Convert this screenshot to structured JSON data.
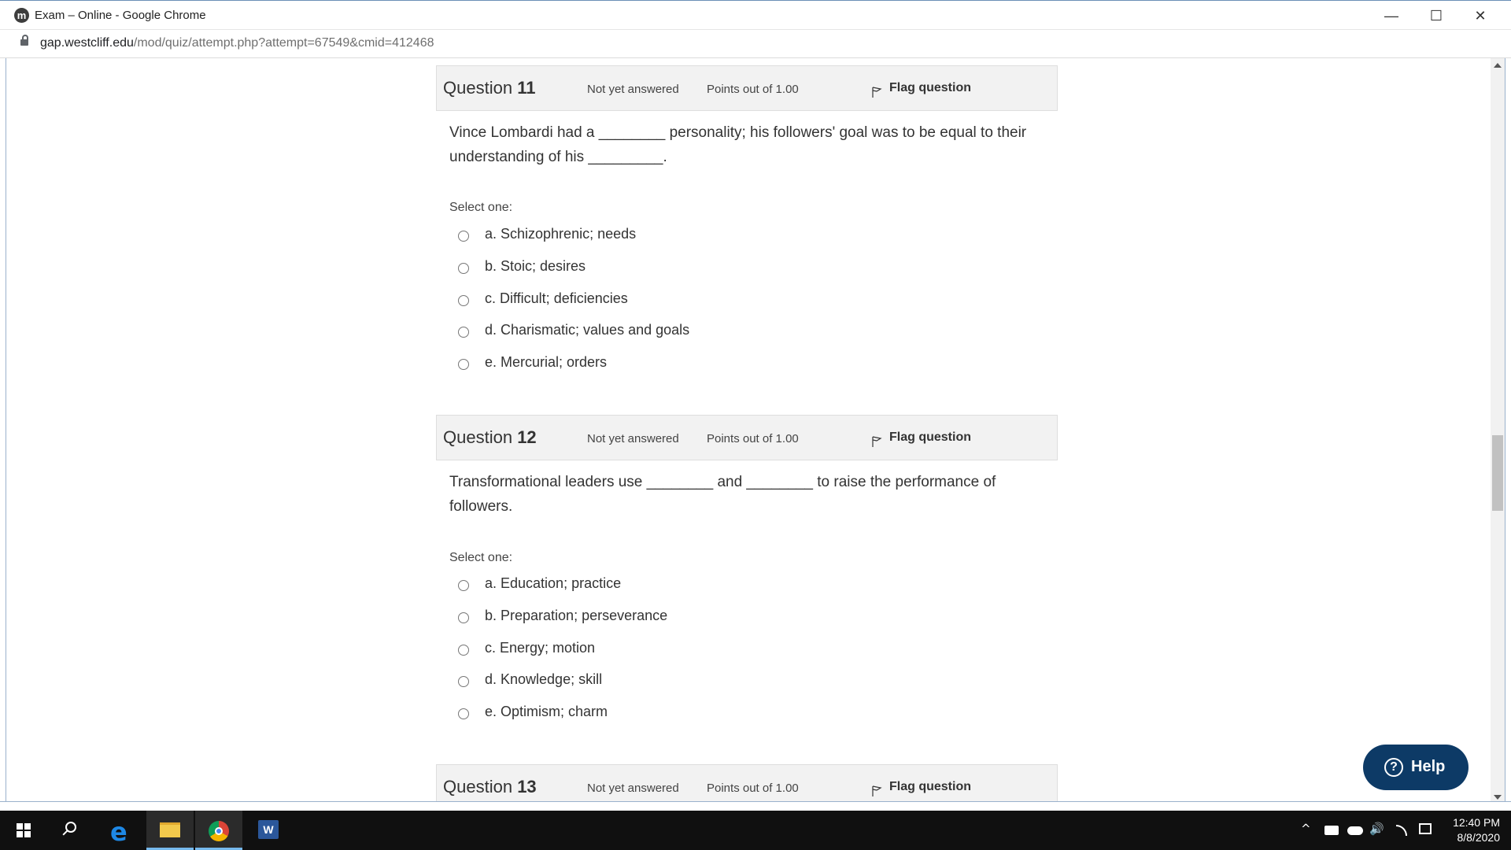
{
  "window": {
    "title": "Exam – Online - Google Chrome",
    "app_icon_letter": "m",
    "minimize": "—",
    "maximize": "☐",
    "close": "✕"
  },
  "address": {
    "host": "gap.westcliff.edu",
    "path": "/mod/quiz/attempt.php?attempt=67549&cmid=412468"
  },
  "questions": [
    {
      "label": "Question",
      "number": "11",
      "state": "Not yet answered",
      "points": "Points out of 1.00",
      "flag": "Flag question",
      "text_line1": "Vince Lombardi had a ________ personality; his followers' goal was to be equal to their",
      "text_line2": "understanding of his _________.",
      "select_one": "Select one:",
      "options": [
        "a. Schizophrenic; needs",
        "b. Stoic; desires",
        "c. Difficult; deficiencies",
        "d. Charismatic; values and goals",
        "e. Mercurial; orders"
      ]
    },
    {
      "label": "Question",
      "number": "12",
      "state": "Not yet answered",
      "points": "Points out of 1.00",
      "flag": "Flag question",
      "text_line1": "Transformational leaders use ________ and ________ to raise the performance of",
      "text_line2": "followers.",
      "select_one": "Select one:",
      "options": [
        "a. Education; practice",
        "b. Preparation; perseverance",
        "c. Energy; motion",
        "d. Knowledge; skill",
        "e. Optimism; charm"
      ]
    },
    {
      "label": "Question",
      "number": "13",
      "state": "Not yet answered",
      "points": "Points out of 1.00",
      "flag": "Flag question"
    }
  ],
  "help": {
    "label": "Help",
    "icon_glyph": "?"
  },
  "taskbar": {
    "time": "12:40 PM",
    "date": "8/8/2020",
    "edge_glyph": "e",
    "word_glyph": "W",
    "tray_up": "^",
    "tray_sound": "🔊"
  },
  "colors": {
    "help_button": "#0d3a66",
    "question_header": "#f2f2f2",
    "taskbar": "#101010"
  }
}
